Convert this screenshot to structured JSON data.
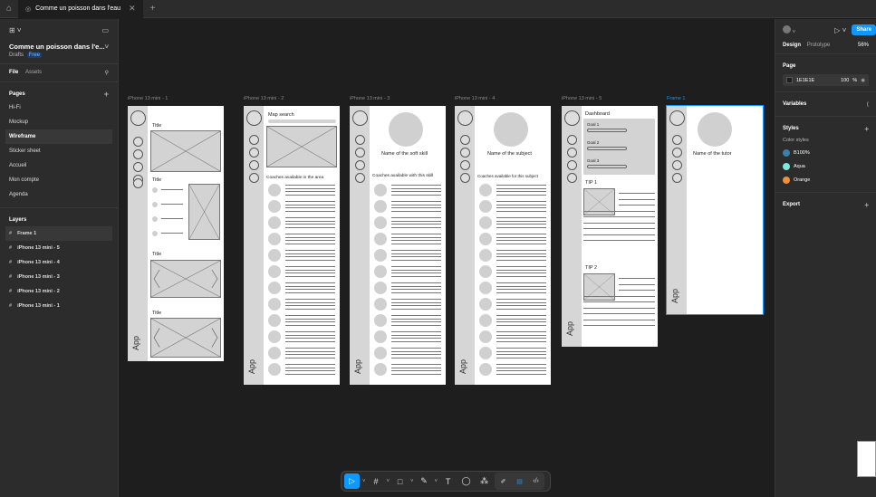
{
  "tabs": {
    "active_label": "Comme un poisson dans l'eau",
    "close_glyph": "✕",
    "add_glyph": "+"
  },
  "left_panel": {
    "project_title": "Comme un poisson dans l'e...",
    "drafts_label": "Drafts",
    "badge": "Free",
    "tab_file": "File",
    "tab_assets": "Assets",
    "pages_heading": "Pages",
    "pages": [
      "Hi-Fi",
      "Mockup",
      "Wireframe",
      "Sticker sheet",
      "Accueil",
      "Mon compte",
      "Agenda"
    ],
    "selected_page": "Wireframe",
    "layers_heading": "Layers",
    "layers": [
      "Frame 1",
      "iPhone 13 mini - 5",
      "iPhone 13 mini - 4",
      "iPhone 13 mini - 3",
      "iPhone 13 mini - 2",
      "iPhone 13 mini - 1"
    ]
  },
  "right_panel": {
    "share_label": "Share",
    "tab_design": "Design",
    "tab_prototype": "Prototype",
    "zoom": "56%",
    "page_heading": "Page",
    "page_color": "1E1E1E",
    "page_opacity": "100",
    "percent": "%",
    "variables_heading": "Variables",
    "styles_heading": "Styles",
    "color_styles_label": "Color styles",
    "color_styles": [
      {
        "name": "B100%",
        "color": "#3d7fa6"
      },
      {
        "name": "Aqua",
        "color": "#7ee8d8"
      },
      {
        "name": "Orange",
        "color": "#f0913a"
      }
    ],
    "export_heading": "Export"
  },
  "frames": {
    "labels": [
      "iPhone 13 mini - 1",
      "iPhone 13 mini - 2",
      "iPhone 13 mini - 3",
      "iPhone 13 mini - 4",
      "iPhone 13 mini - 5",
      "Frame 1"
    ],
    "app_label": "App",
    "f1_titles": [
      "Title",
      "Title",
      "Title",
      "Title"
    ],
    "f2_title": "Map search",
    "f2_list_title": "Coaches available in the area",
    "f3_title": "Name of the soft skill",
    "f3_list_title": "Coaches available with this skill",
    "f4_title": "Name of the subject",
    "f4_list_title": "Coaches available for this subject",
    "f5_title": "Dashboard",
    "f5_goals": [
      "Goal 1",
      "Goal 2",
      "Goal 3"
    ],
    "f5_tips": [
      "TIP 1",
      "TIP 2"
    ],
    "f6_title": "Name of the tutor"
  },
  "toolbar": {
    "frame_glyph": "#",
    "text_glyph": "T"
  },
  "colors": {
    "accent": "#0d99ff",
    "canvas": "#1e1e1e",
    "panel": "#2c2c2c"
  }
}
